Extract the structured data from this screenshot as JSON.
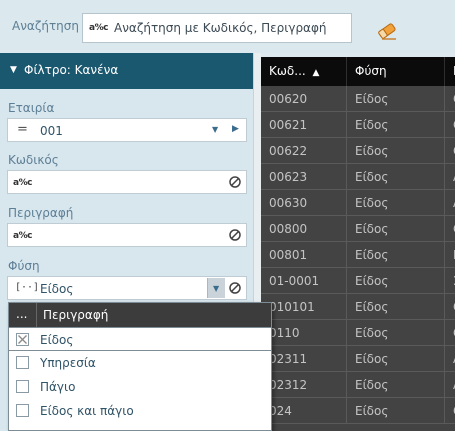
{
  "search": {
    "label": "Αναζήτηση",
    "axc_badge": "a%c",
    "text": "Αναζήτηση με Κωδικός, Περιγραφή",
    "clear_icon": "eraser-icon"
  },
  "filter": {
    "arrow": "▼",
    "title": "Φίλτρο: Κανένα",
    "company": {
      "label": "Εταιρία",
      "operator": "=",
      "value": "001"
    },
    "code": {
      "label": "Κωδικός",
      "badge": "a%c"
    },
    "description": {
      "label": "Περιγραφή",
      "badge": "a%c"
    },
    "nature": {
      "label": "Φύση",
      "badge": "[··]",
      "value": "Είδος"
    }
  },
  "grid": {
    "columns": [
      {
        "label": "Κωδ...",
        "sort": "▲"
      },
      {
        "label": "Φύση"
      },
      {
        "label": "Π"
      }
    ],
    "rows": [
      {
        "code": "00620",
        "nature": "Είδος",
        "extra": "Ο"
      },
      {
        "code": "00621",
        "nature": "Είδος",
        "extra": "Ο"
      },
      {
        "code": "00622",
        "nature": "Είδος",
        "extra": "Ο"
      },
      {
        "code": "00623",
        "nature": "Είδος",
        "extra": "Α"
      },
      {
        "code": "00630",
        "nature": "Είδος",
        "extra": "Α"
      },
      {
        "code": "00800",
        "nature": "Είδος",
        "extra": "Ο"
      },
      {
        "code": "00801",
        "nature": "Είδος",
        "extra": "Π"
      },
      {
        "code": "01-0001",
        "nature": "Είδος",
        "extra": "Σ"
      },
      {
        "code": "010101",
        "nature": "Είδος",
        "extra": "Ο"
      },
      {
        "code": "0110",
        "nature": "Είδος",
        "extra": "Ο"
      },
      {
        "code": "02311",
        "nature": "Είδος",
        "extra": "Α"
      },
      {
        "code": "02312",
        "nature": "Είδος",
        "extra": "Α"
      },
      {
        "code": "024",
        "nature": "Είδος",
        "extra": "Ο"
      }
    ]
  },
  "dropdown": {
    "header_dots": "...",
    "column": "Περιγραφή",
    "options": [
      {
        "label": "Είδος",
        "checked": true
      },
      {
        "label": "Υπηρεσία",
        "checked": false
      },
      {
        "label": "Πάγιο",
        "checked": false
      },
      {
        "label": "Είδος και πάγιο",
        "checked": false
      }
    ]
  },
  "colors": {
    "filter_header": "#1a5870",
    "panel_bg": "#d8e6ee",
    "grid_header": "#0b0b0b",
    "grid_body": "#434343",
    "label_text": "#5d7f95"
  }
}
